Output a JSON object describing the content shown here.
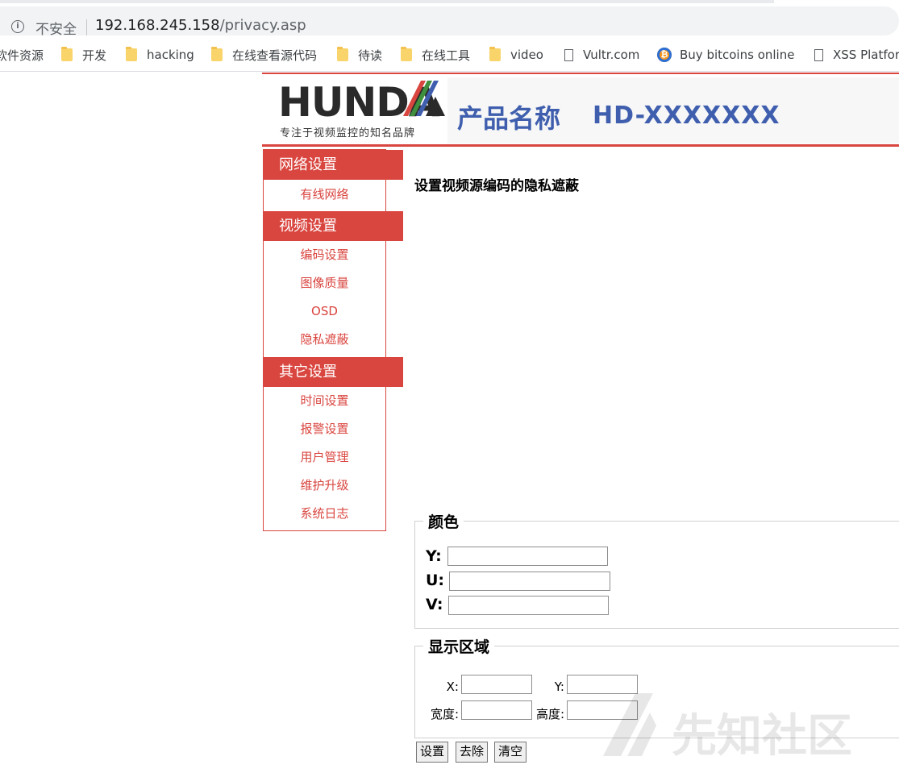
{
  "browser": {
    "security_label": "不安全",
    "url_host": "192.168.245.158",
    "url_path": "/privacy.asp",
    "bookmarks": [
      {
        "label": "软件资源",
        "icon": "none"
      },
      {
        "label": "开发",
        "icon": "folder-icon"
      },
      {
        "label": "hacking",
        "icon": "folder-icon"
      },
      {
        "label": "在线查看源代码",
        "icon": "folder-icon"
      },
      {
        "label": "待读",
        "icon": "folder-icon"
      },
      {
        "label": "在线工具",
        "icon": "folder-icon"
      },
      {
        "label": "video",
        "icon": "folder-icon"
      },
      {
        "label": "Vultr.com",
        "icon": "page-icon"
      },
      {
        "label": "Buy bitcoins online",
        "icon": "bitcoin-icon"
      },
      {
        "label": "XSS Platfor",
        "icon": "page-icon"
      }
    ]
  },
  "banner": {
    "logo": "HUNDA",
    "slogan": "专注于视频监控的知名品牌",
    "product_label": "产品名称",
    "product_model": "HD-XXXXXXX"
  },
  "sidebar": {
    "sections": [
      {
        "title": "网络设置",
        "items": [
          "有线网络"
        ]
      },
      {
        "title": "视频设置",
        "items": [
          "编码设置",
          "图像质量",
          "OSD",
          "隐私遮蔽"
        ]
      },
      {
        "title": "其它设置",
        "items": [
          "时间设置",
          "报警设置",
          "用户管理",
          "维护升级",
          "系统日志"
        ]
      }
    ]
  },
  "main": {
    "heading": "设置视频源编码的隐私遮蔽",
    "color_group": {
      "legend": "颜色",
      "y_label": "Y:",
      "y_value": "",
      "u_label": "U:",
      "u_value": "",
      "v_label": "V:",
      "v_value": ""
    },
    "area_group": {
      "legend": "显示区域",
      "x_label": "X:",
      "x_value": "",
      "y_label": "Y:",
      "y_value": "",
      "w_label": "宽度:",
      "w_value": "",
      "h_label": "高度:",
      "h_value": ""
    },
    "buttons": {
      "set": "设置",
      "remove": "去除",
      "clear": "清空"
    }
  },
  "watermark": "先知社区",
  "colors": {
    "accent": "#d9453f",
    "product": "#3f5fae"
  }
}
